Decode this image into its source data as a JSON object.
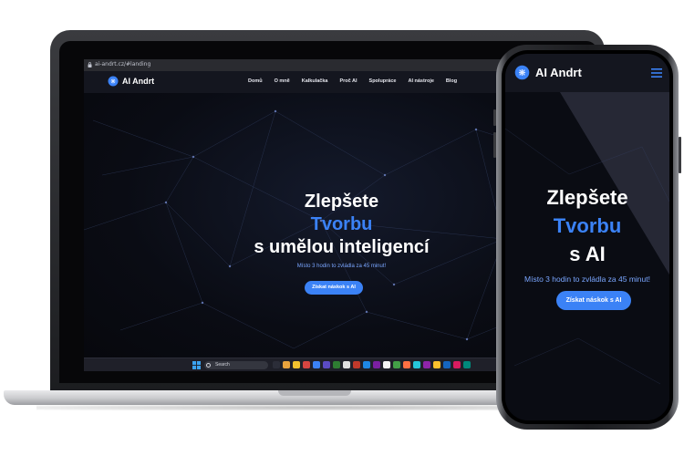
{
  "browser": {
    "url": "ai-andrt.cz/#landing"
  },
  "site": {
    "brand": "AI Andrt",
    "nav": [
      "Domů",
      "O mně",
      "Kalkulačka",
      "Proč AI",
      "Spolupráce",
      "AI nástroje",
      "Blog"
    ]
  },
  "laptop_hero": {
    "line1": "Zlepšete",
    "line2": "Tvorbu",
    "line3": "s umělou inteligencí",
    "subtitle": "Místo 3 hodin to zvládla za 45 minut!",
    "cta": "Získat náskok s AI"
  },
  "taskbar": {
    "search_label": "Search"
  },
  "phone_hero": {
    "line1": "Zlepšete",
    "line2": "Tvorbu",
    "line3": "s AI",
    "subtitle": "Místo 3 hodin to zvládla za 45 minut!",
    "cta": "Získat náskok s AI"
  },
  "colors": {
    "accent": "#3b82f6",
    "background": "#0b0c12",
    "nav": "#14161f"
  }
}
